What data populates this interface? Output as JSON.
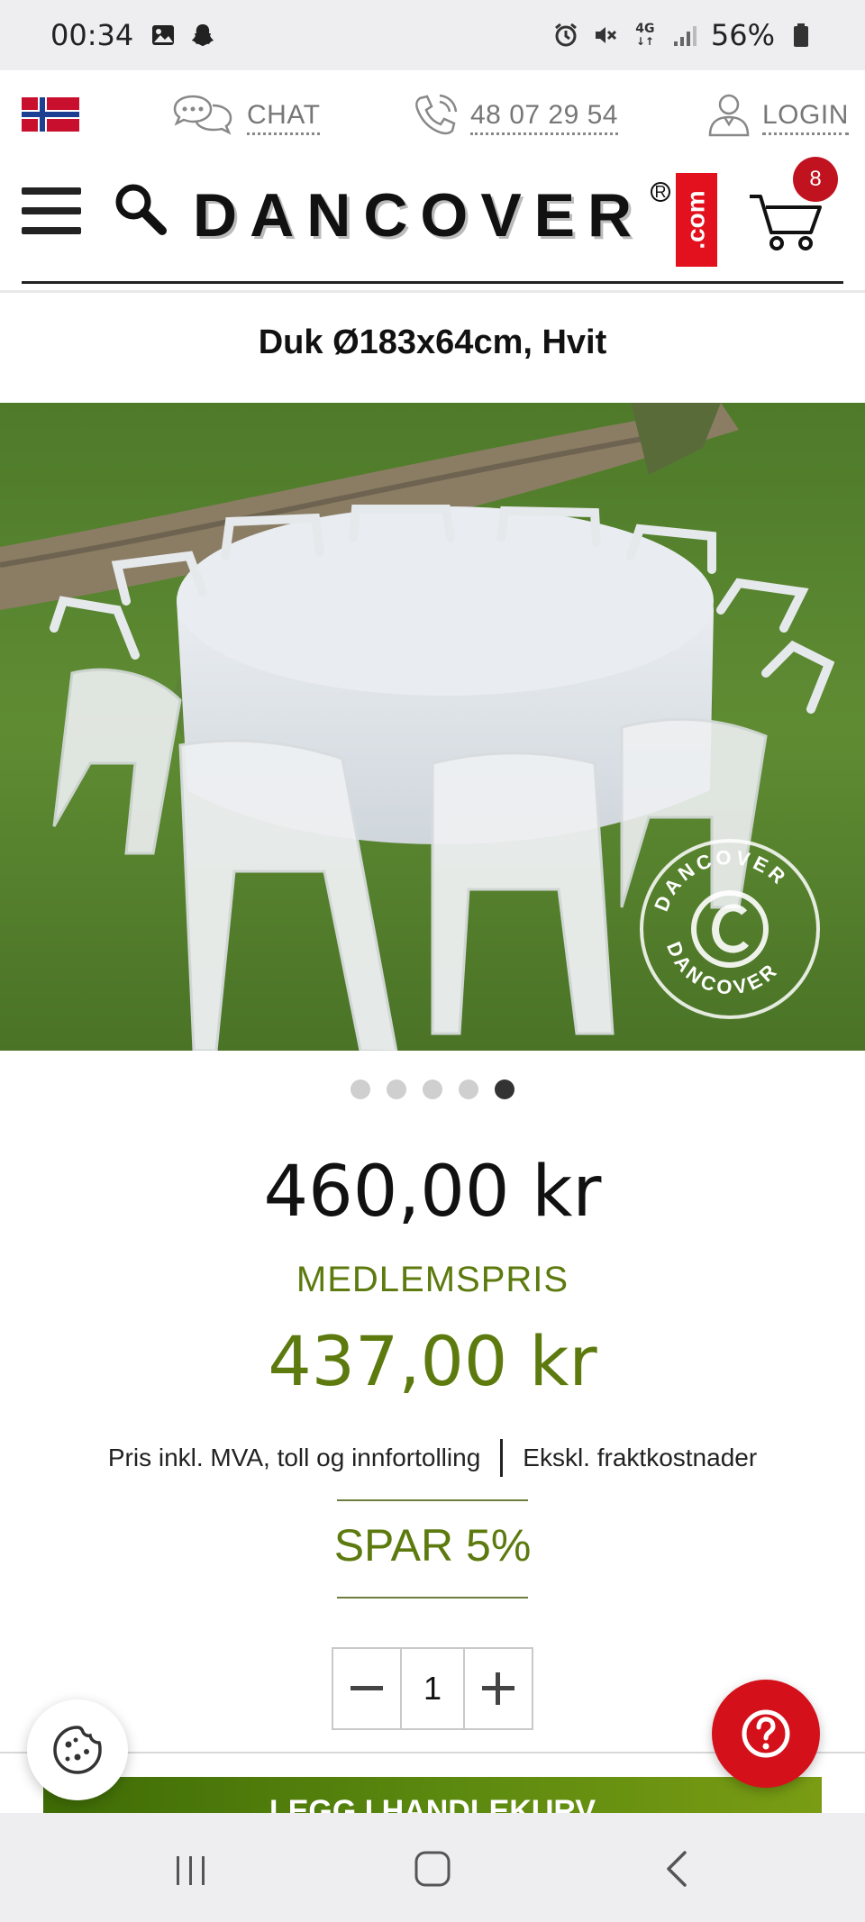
{
  "status_bar": {
    "time": "00:34",
    "network": "4G",
    "battery": "56%"
  },
  "utility": {
    "chat_label": "CHAT",
    "phone_label": "48 07 29 54",
    "login_label": "LOGIN"
  },
  "header": {
    "logo_text": "DANCOVER",
    "logo_suffix": ".com",
    "logo_registered": "R",
    "cart_count": "8"
  },
  "product": {
    "title": "Duk Ø183x64cm, Hvit",
    "image_watermark_top": "DANCOVER",
    "image_watermark_bottom": "DANCOVER",
    "carousel": {
      "total": 5,
      "active_index": 4
    },
    "price": "460,00 kr",
    "member_label": "MEDLEMSPRIS",
    "member_price": "437,00 kr",
    "tax_note": "Pris inkl. MVA, toll og innfortolling",
    "freight_note": "Ekskl. fraktkostnader",
    "discount": "SPAR 5%",
    "quantity": "1"
  },
  "cta": {
    "label": "LEGG I HANDLEKURV"
  },
  "colors": {
    "brand_red": "#e3101d",
    "member_green": "#5c7a0e",
    "cta_green": "#4a7a08"
  },
  "icons": {
    "flag": "norway-flag-icon",
    "chat": "chat-bubbles-icon",
    "phone": "phone-icon",
    "login": "user-icon",
    "menu": "hamburger-menu-icon",
    "search": "search-icon",
    "cart": "shopping-cart-icon",
    "cookie": "cookie-icon",
    "help": "question-mark-icon"
  }
}
